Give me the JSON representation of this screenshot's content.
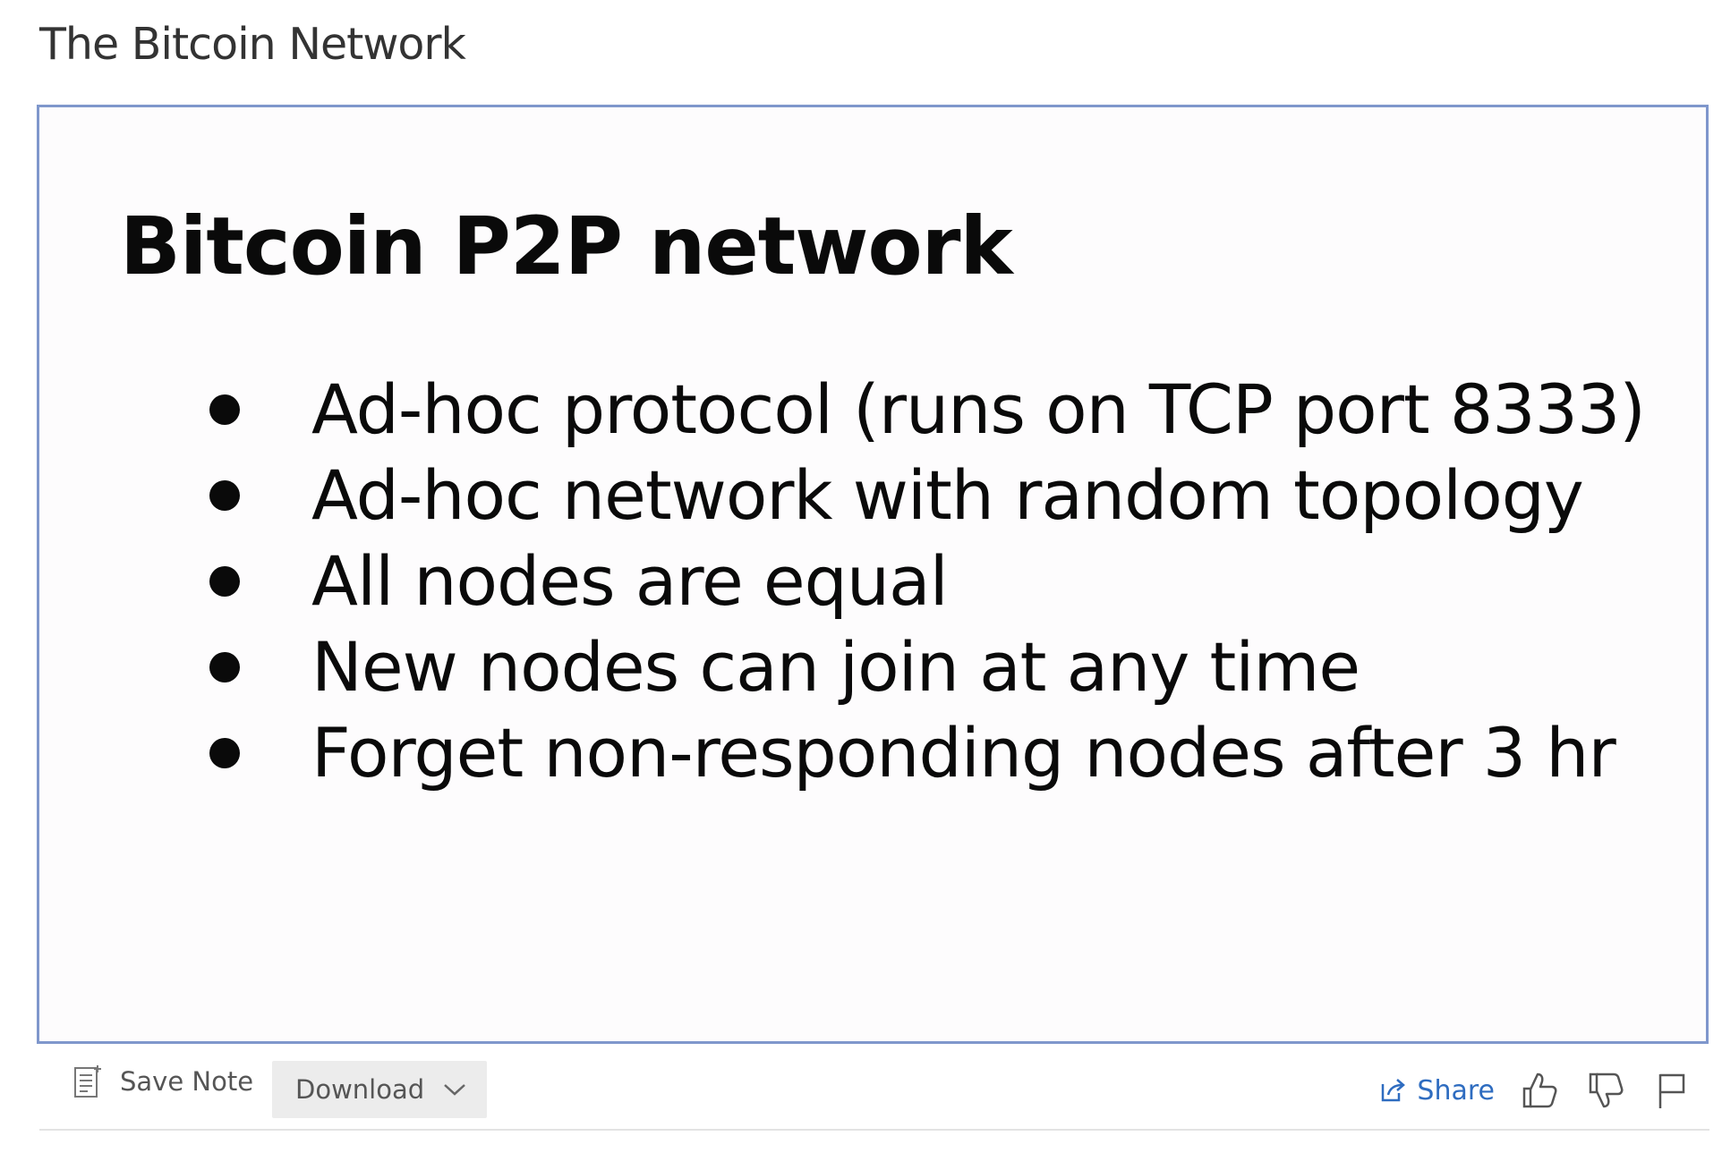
{
  "page": {
    "title": "The Bitcoin Network"
  },
  "slide": {
    "heading": "Bitcoin P2P network",
    "bullets": [
      "Ad-hoc protocol (runs on TCP port 8333)",
      "Ad-hoc network with random topology",
      "All nodes are equal",
      "New nodes can join at any time",
      "Forget non-responding nodes after 3 hr"
    ]
  },
  "toolbar": {
    "save_note_label": "Save Note",
    "save_note_icon": "note-icon",
    "download_label": "Download",
    "download_icon": "chevron-down-icon",
    "share_label": "Share",
    "share_icon": "share-icon",
    "like_icon": "thumbs-up-icon",
    "dislike_icon": "thumbs-down-icon",
    "flag_icon": "flag-icon"
  },
  "colors": {
    "slide_border": "#7f97cc",
    "share_link": "#2e6cc0",
    "download_bg": "#ececec"
  }
}
